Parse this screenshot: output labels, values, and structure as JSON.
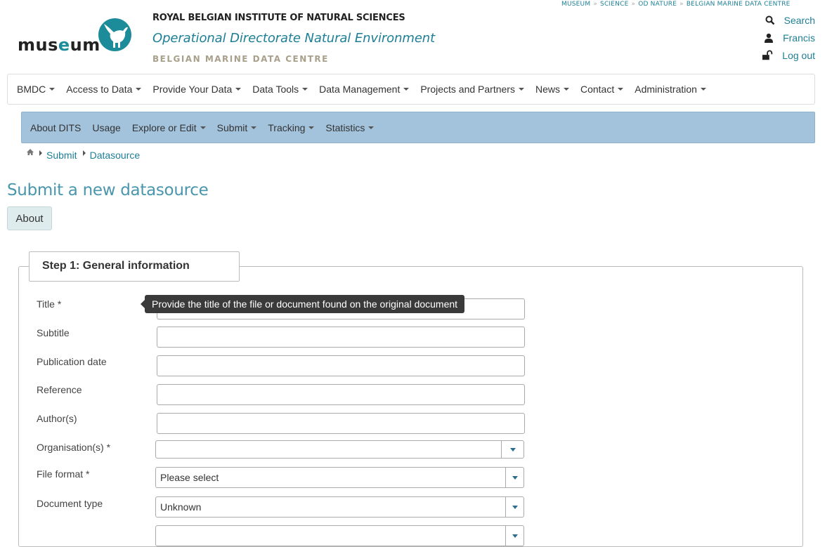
{
  "top_links": [
    "MUSEUM",
    "SCIENCE",
    "OD NATURE",
    "BELGIAN MARINE DATA CENTRE"
  ],
  "logo": {
    "pre": "mus",
    "e": "e",
    "post": "um"
  },
  "header": {
    "institute": "ROYAL BELGIAN INSTITUTE OF NATURAL SCIENCES",
    "directorate": "Operational Directorate Natural Environment",
    "centre": "BELGIAN MARINE DATA CENTRE"
  },
  "user_menu": {
    "search": "Search",
    "user": "Francis",
    "logout": "Log out"
  },
  "main_nav": [
    "BMDC",
    "Access to Data",
    "Provide Your Data",
    "Data Tools",
    "Data Management",
    "Projects and Partners",
    "News",
    "Contact",
    "Administration"
  ],
  "sub_nav": [
    {
      "label": "About DITS",
      "dropdown": false
    },
    {
      "label": "Usage",
      "dropdown": false
    },
    {
      "label": "Explore or Edit",
      "dropdown": true
    },
    {
      "label": "Submit",
      "dropdown": true
    },
    {
      "label": "Tracking",
      "dropdown": true
    },
    {
      "label": "Statistics",
      "dropdown": true
    }
  ],
  "breadcrumb": [
    "Submit",
    "Datasource"
  ],
  "page_title": "Submit a new datasource",
  "about_button": "About",
  "step_legend": "Step 1: General information",
  "tooltip": "Provide the title of the file or document found on the original document",
  "fields": {
    "title": "Title",
    "subtitle": "Subtitle",
    "publication_date": "Publication date",
    "reference": "Reference",
    "authors": "Author(s)",
    "organisations": "Organisation(s)",
    "file_format": "File format",
    "document_type": "Document type"
  },
  "required_mark": "*",
  "selects": {
    "organisations_value": "",
    "file_format_value": "Please select",
    "document_type_value": "Unknown"
  },
  "colors": {
    "accent": "#1d7f95",
    "subnav_bg": "#a3c3dc",
    "about_bg": "#dfecee"
  }
}
